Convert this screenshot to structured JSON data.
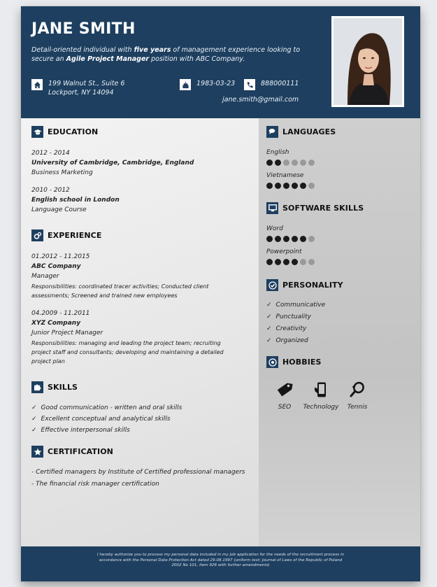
{
  "header": {
    "name": "JANE SMITH",
    "summary_pre": "Detail-oriented individual with ",
    "summary_bold1": "five years",
    "summary_mid": " of management experience looking to secure an ",
    "summary_bold2": "Agile Project Manager",
    "summary_post": " position with ABC Company.",
    "address_line1": "199 Walnut St., Suite 6",
    "address_line2": "Lockport, NY 14094",
    "birthdate": "1983-03-23",
    "phone": "888000111",
    "email": "jane.smith@gmail.com"
  },
  "education": {
    "title": "EDUCATION",
    "items": [
      {
        "period": "2012 - 2014",
        "school": "University of Cambridge, Cambridge, England",
        "field": "Business Marketing"
      },
      {
        "period": "2010 - 2012",
        "school": "English school in London",
        "field": "Language Course"
      }
    ]
  },
  "experience": {
    "title": "EXPERIENCE",
    "items": [
      {
        "period": "01.2012 - 11.2015",
        "company": "ABC Company",
        "role": "Manager",
        "resp_line1": "Responsibilities: coordinated tracer activities; Conducted client",
        "resp_line2": "assessments; Screened and trained new employees"
      },
      {
        "period": "04.2009 - 11.2011",
        "company": "XYZ Company",
        "role": "Junior Project Manager",
        "resp_line1": "Responsibilities: managing and leading the project team; recruiting",
        "resp_line2": "project staff and consultants; developing and maintaining a detailed",
        "resp_line3": "project plan"
      }
    ]
  },
  "skills": {
    "title": "SKILLS",
    "items": [
      "Good communication - written and oral skills",
      "Excellent conceptual and analytical skills",
      "Effective interpersonal skills"
    ]
  },
  "certification": {
    "title": "CERTIFICATION",
    "items": [
      "- Certified managers by Institute of Certified professional managers",
      "- The financial risk manager certification"
    ]
  },
  "languages": {
    "title": "LANGUAGES",
    "items": [
      {
        "name": "English",
        "level": 2,
        "max": 6
      },
      {
        "name": "Vietnamese",
        "level": 5,
        "max": 6
      }
    ]
  },
  "software": {
    "title": "SOFTWARE SKILLS",
    "items": [
      {
        "name": "Word",
        "level": 5,
        "max": 6
      },
      {
        "name": "Powerpoint",
        "level": 4,
        "max": 6
      }
    ]
  },
  "personality": {
    "title": "PERSONALITY",
    "items": [
      "Communicative",
      "Punctuality",
      "Creativity",
      "Organized"
    ]
  },
  "hobbies": {
    "title": "HOBBIES",
    "items": [
      {
        "label": "SEO",
        "icon": "seo-tag-icon"
      },
      {
        "label": "Technology",
        "icon": "smartphone-icon"
      },
      {
        "label": "Tennis",
        "icon": "tennis-racket-icon"
      }
    ]
  },
  "footer": {
    "line1": "I hereby authorize you to process my personal data included in my job application for the needs of the recruitment process in",
    "line2": "accordance with the Personal Data Protection Act dated 29.08.1997 (uniform text: Journal of Laws of the Republic of Poland",
    "line3": "2002 No 101, item 926 with further amendments)"
  },
  "colors": {
    "primary": "#1e3f5f",
    "dot_on": "#1b1b1b",
    "dot_off": "#9a9a9a"
  }
}
